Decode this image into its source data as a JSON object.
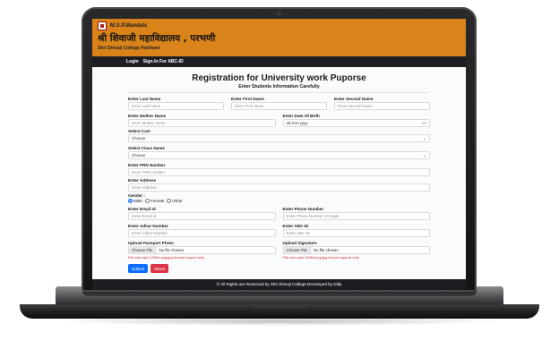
{
  "header": {
    "org": "M.S.P.Mandals",
    "college_marathi": "श्री शिवाजी महाविद्यालय , परभणी",
    "college_english": "Shri Shivaji College Parbhani",
    "brand_color": "#d9831a"
  },
  "nav": {
    "items": [
      "Login",
      "Sign-In For ABC-ID"
    ]
  },
  "form": {
    "title": "Registration for University work Puporse",
    "subtitle": "Enter Students Information Carefully",
    "last_name": {
      "label": "Enter Last Name",
      "placeholder": "Enter Last name"
    },
    "first_name": {
      "label": "Enter First Name",
      "placeholder": "Enter First name"
    },
    "second_name": {
      "label": "Enter Second Name",
      "placeholder": "Enter Second name"
    },
    "mother_name": {
      "label": "Enter Mother Name",
      "placeholder": "Enter Mother name"
    },
    "dob": {
      "label": "Enter Date Of Birth",
      "placeholder": "dd-mm-yyyy"
    },
    "cast": {
      "label": "Select Cast",
      "value": "Choose"
    },
    "class_name": {
      "label": "Select Class Name",
      "value": "Choose"
    },
    "prn": {
      "label": "Enter PRN Number",
      "placeholder": "Enter PRN number"
    },
    "address": {
      "label": "Enter Address",
      "placeholder": "Enter Address"
    },
    "gender": {
      "label": "Gender :",
      "options": [
        "Male",
        "Female",
        "Other"
      ],
      "selected": "Male"
    },
    "email": {
      "label": "Enter Email Id",
      "placeholder": "Enter Email id"
    },
    "phone": {
      "label": "Enter Phone Number",
      "placeholder": "Enter Phone Number 10 digits"
    },
    "adhar": {
      "label": "Enter Adhar Number",
      "placeholder": "Enter Adhar Number"
    },
    "abc": {
      "label": "Enter ABC-ID",
      "placeholder": "Enter ABC-ID"
    },
    "photo": {
      "label": "Upload Passport Photo",
      "button": "Choose File",
      "status": "No file chosen",
      "hint": "File size upto 100kb png/jpg format support only"
    },
    "signature": {
      "label": "Upload Signature",
      "button": "Choose File",
      "status": "No file chosen",
      "hint": "File size upto 100kb png/jpg format support only"
    },
    "submit_label": "Submit",
    "reset_label": "Reset"
  },
  "footer": {
    "text": "© All Rights are Reserved by Shri Shivaji College Developed by Dilip"
  },
  "icons": {
    "select": "chevron-down-icon",
    "date": "calendar-icon",
    "logo": "college-logo-icon"
  }
}
